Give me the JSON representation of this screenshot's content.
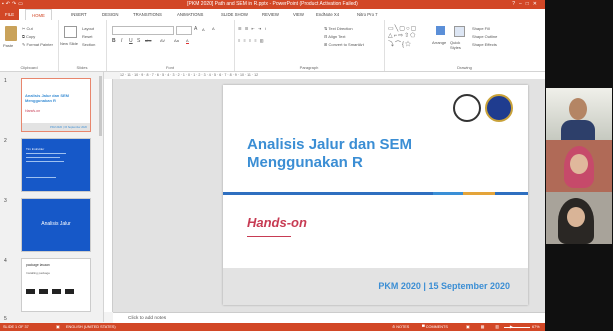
{
  "window": {
    "title": "[PKM 2020] Path and SEM in R.pptx - PowerPoint (Product Activation Failed)",
    "quick_access": [
      "save-icon",
      "undo-icon",
      "redo-icon",
      "present-icon"
    ]
  },
  "tabs": [
    "FILE",
    "HOME",
    "INSERT",
    "DESIGN",
    "TRANSITIONS",
    "ANIMATIONS",
    "SLIDE SHOW",
    "REVIEW",
    "VIEW",
    "EndNote X4",
    "Nitro Pro 7"
  ],
  "active_tab": "HOME",
  "ribbon": {
    "clipboard": {
      "label": "Clipboard",
      "paste": "Paste",
      "cut": "Cut",
      "copy": "Copy",
      "format_painter": "Format Painter"
    },
    "slides": {
      "label": "Slides",
      "new_slide": "New Slide",
      "layout": "Layout",
      "reset": "Reset",
      "section": "Section"
    },
    "font": {
      "label": "Font",
      "bold": "B",
      "italic": "I",
      "underline": "U",
      "strike": "S",
      "shadow": "abc",
      "spacing": "AV",
      "case": "Aa",
      "color": "A",
      "grow": "A",
      "shrink": "A",
      "clear": "A"
    },
    "paragraph": {
      "label": "Paragraph",
      "text_direction": "Text Direction",
      "align_text": "Align Text",
      "smartart": "Convert to SmartArt"
    },
    "drawing": {
      "label": "Drawing",
      "arrange": "Arrange",
      "quick_styles": "Quick Styles",
      "shape_fill": "Shape Fill",
      "shape_outline": "Shape Outline",
      "shape_effects": "Shape Effects"
    }
  },
  "ruler_ticks": "12 · 11 · 10 · 9 · 8 · 7 · 6 · 5 · 4 · 3 · 2 · 1 · 0 · 1 · 2 · 3 · 4 · 5 · 6 · 7 · 8 · 9 · 10 · 11 · 12",
  "thumbnails": [
    {
      "num": "1",
      "text_1": "Analisis Jalur dan SEM",
      "text_2": "Menggunakan R",
      "text_3": "Hands-on",
      "text_4": "PKM 2020 | 15 September 2020"
    },
    {
      "num": "2",
      "text_1": "Tim Instruktur",
      "text_2": "",
      "text_3": "",
      "text_4": ""
    },
    {
      "num": "3",
      "text_1": "Analisis Jalur",
      "text_2": "",
      "text_3": "",
      "text_4": ""
    },
    {
      "num": "4",
      "text_1": "package lavaan",
      "text_2": "Installing package",
      "text_3": "",
      "text_4": ""
    },
    {
      "num": "5",
      "text_1": "",
      "text_2": "",
      "text_3": "",
      "text_4": ""
    }
  ],
  "slide": {
    "title_line1": "Analisis Jalur dan SEM",
    "title_line2": "Menggunakan R",
    "subtitle": "Hands-on",
    "footer": "PKM 2020 | 15 September 2020",
    "stripe_colors": [
      "#2e6fc0",
      "#3a8fd6",
      "#e4a43a",
      "#2e6fc0"
    ]
  },
  "notes_placeholder": "Click to add notes",
  "status": {
    "slide_of": "SLIDE 1 OF 37",
    "language": "ENGLISH (UNITED STATES)",
    "notes": "NOTES",
    "comments": "COMMENTS",
    "zoom": "67%"
  },
  "colors": {
    "accent": "#d24726",
    "slide_title": "#3b8ed4",
    "hands_on": "#c73b53"
  }
}
